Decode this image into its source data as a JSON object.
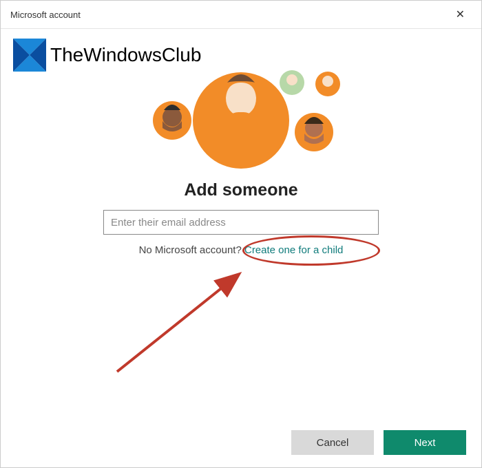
{
  "titlebar": {
    "title": "Microsoft account"
  },
  "watermark": {
    "text": "TheWindowsClub"
  },
  "main": {
    "heading": "Add someone",
    "email_placeholder": "Enter their email address",
    "email_value": "",
    "helper_prefix": "No Microsoft account?",
    "child_link": "Create one for a child"
  },
  "footer": {
    "cancel": "Cancel",
    "next": "Next"
  },
  "colors": {
    "link": "#0f7b7b",
    "next_bg": "#0f8a6c",
    "annotation": "#c0392b"
  }
}
